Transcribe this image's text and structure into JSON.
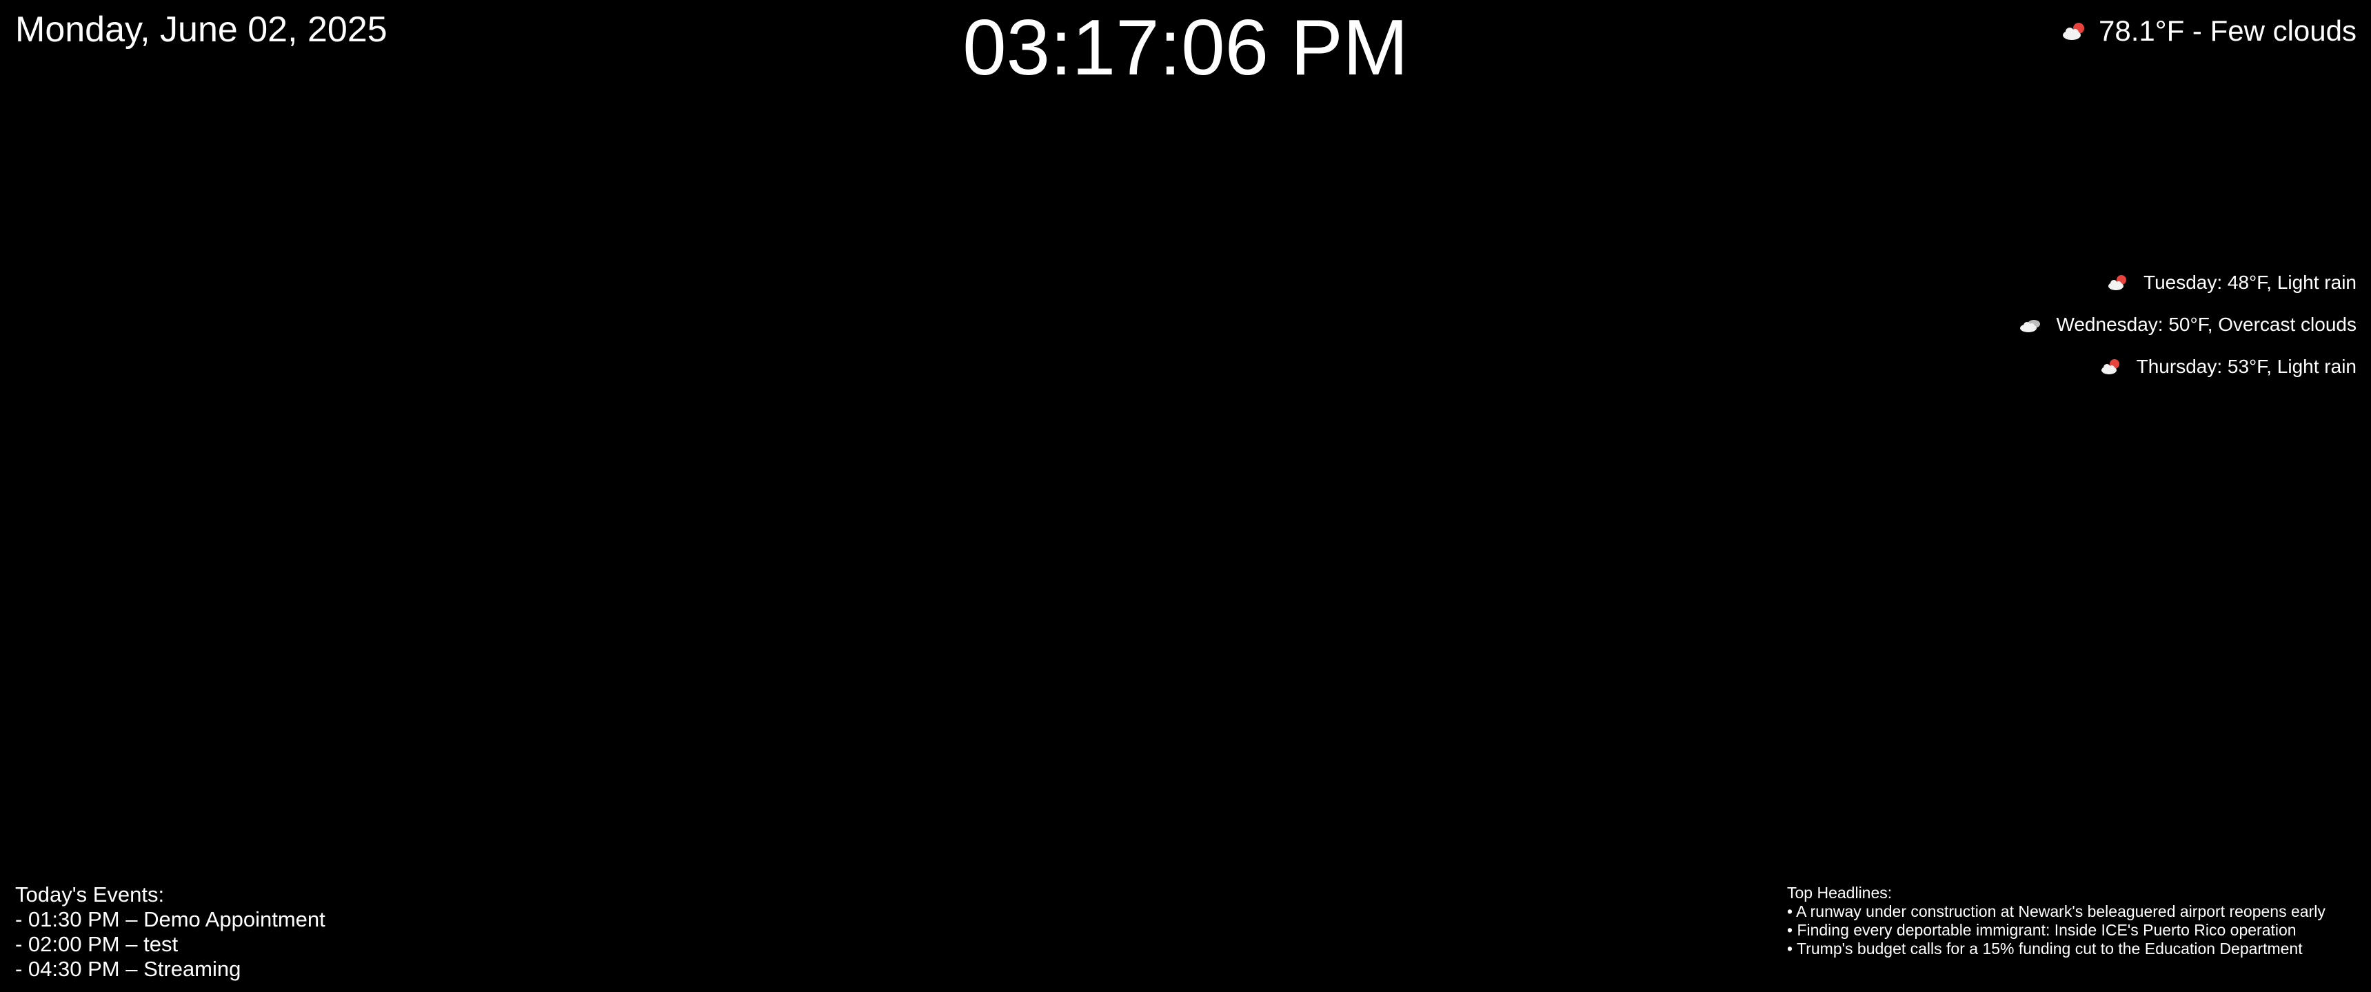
{
  "date": "Monday, June 02, 2025",
  "time": "03:17:06 PM",
  "current_weather": {
    "icon": "few-clouds-icon",
    "text": "78.1°F - Few clouds"
  },
  "forecast": [
    {
      "icon": "light-rain-icon",
      "text": "Tuesday: 48°F, Light rain"
    },
    {
      "icon": "overcast-clouds-icon",
      "text": "Wednesday: 50°F, Overcast clouds"
    },
    {
      "icon": "light-rain-icon",
      "text": "Thursday: 53°F, Light rain"
    }
  ],
  "events": {
    "title": "Today's Events:",
    "items": [
      "- 01:30 PM – Demo Appointment",
      "- 02:00 PM – test",
      "- 04:30 PM – Streaming"
    ]
  },
  "headlines": {
    "title": "Top Headlines:",
    "items": [
      "• A runway under construction at Newark's beleaguered airport reopens early",
      "• Finding every deportable immigrant: Inside ICE's Puerto Rico operation",
      "• Trump's budget calls for a 15% funding cut to the Education Department"
    ]
  },
  "colors": {
    "background": "#000000",
    "text": "#ffffff",
    "sun": "#e8423c",
    "cloud": "#f2f2f2"
  }
}
